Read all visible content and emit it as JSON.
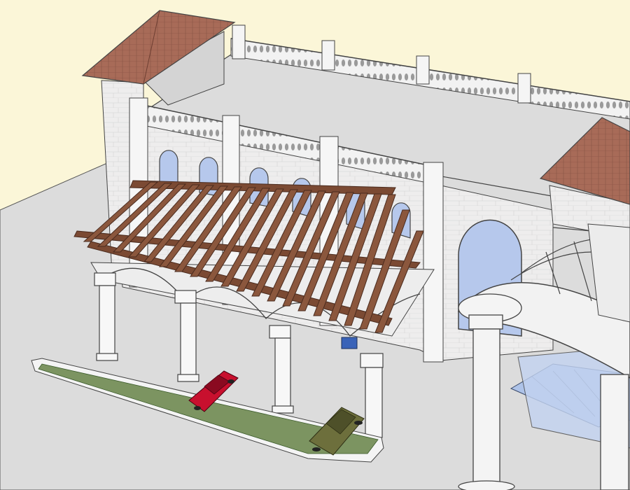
{
  "scene": {
    "description_label": "",
    "colors": {
      "sky": "#fbf6d8",
      "ground": "#dcdcdc",
      "roof_tile": "#a86b58",
      "stone_wall": "#ecebea",
      "window_glass": "#b6c8ec",
      "pergola_wood": "#7b4a33",
      "lawn": "#7c9461",
      "car_red": "#c8102e",
      "car_olive": "#6d6f3c",
      "glass_canopy": "#aec3e8",
      "column": "#f4f4f4",
      "outline": "#3a3a3a"
    },
    "icons": [
      "red-car-icon",
      "olive-car-icon",
      "blue-car-icon"
    ]
  }
}
